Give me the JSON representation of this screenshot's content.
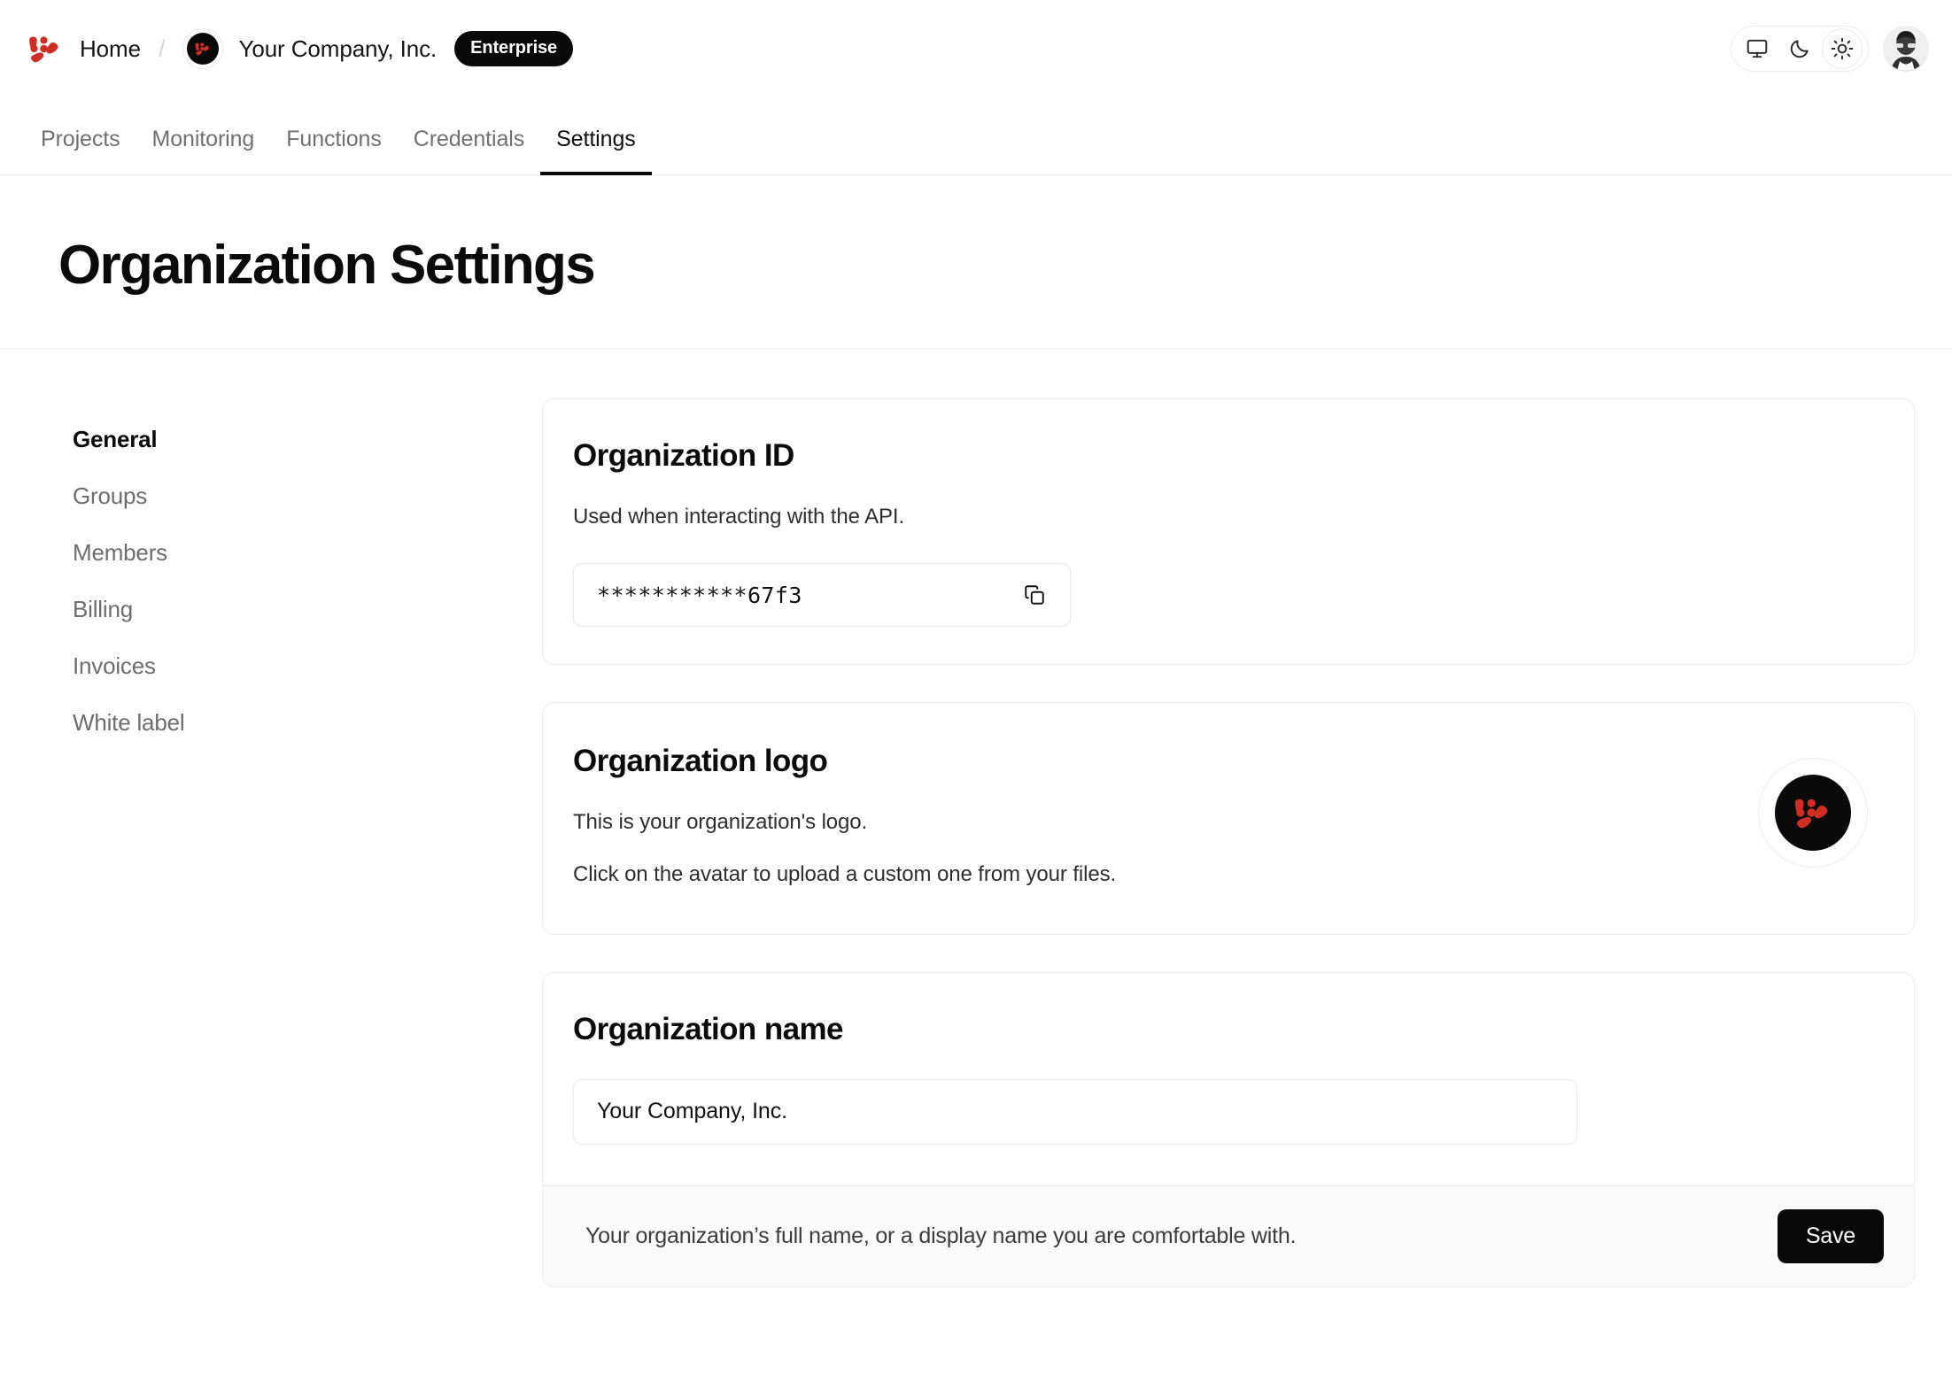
{
  "brand": {
    "logo_icon": "dotted-arrow-logo",
    "accent_color": "#cf2e26",
    "avatar_bg": "#0a0a0a"
  },
  "topbar": {
    "home_label": "Home",
    "separator": "/",
    "org_name": "Your Company, Inc.",
    "plan_badge": "Enterprise",
    "theme": {
      "options": [
        "system-monitor-icon",
        "moon-icon",
        "sun-icon"
      ],
      "selected": "sun-icon"
    },
    "user_avatar": "user-avatar"
  },
  "nav": {
    "tabs": [
      {
        "label": "Projects",
        "active": false
      },
      {
        "label": "Monitoring",
        "active": false
      },
      {
        "label": "Functions",
        "active": false
      },
      {
        "label": "Credentials",
        "active": false
      },
      {
        "label": "Settings",
        "active": true
      }
    ]
  },
  "page": {
    "title": "Organization Settings"
  },
  "sidebar": {
    "items": [
      {
        "label": "General",
        "active": true
      },
      {
        "label": "Groups",
        "active": false
      },
      {
        "label": "Members",
        "active": false
      },
      {
        "label": "Billing",
        "active": false
      },
      {
        "label": "Invoices",
        "active": false
      },
      {
        "label": "White label",
        "active": false
      }
    ]
  },
  "cards": {
    "org_id": {
      "title": "Organization ID",
      "description": "Used when interacting with the API.",
      "value": "***********67f3",
      "copy_icon": "copy-icon"
    },
    "org_logo": {
      "title": "Organization logo",
      "description_1": "This is your organization's logo.",
      "description_2": "Click on the avatar to upload a custom one from your files.",
      "avatar_icon": "dotted-arrow-logo"
    },
    "org_name": {
      "title": "Organization name",
      "value": "Your Company, Inc.",
      "placeholder": "Organization name",
      "footer_hint": "Your organization’s full name, or a display name you are comfortable with.",
      "save_label": "Save"
    }
  }
}
